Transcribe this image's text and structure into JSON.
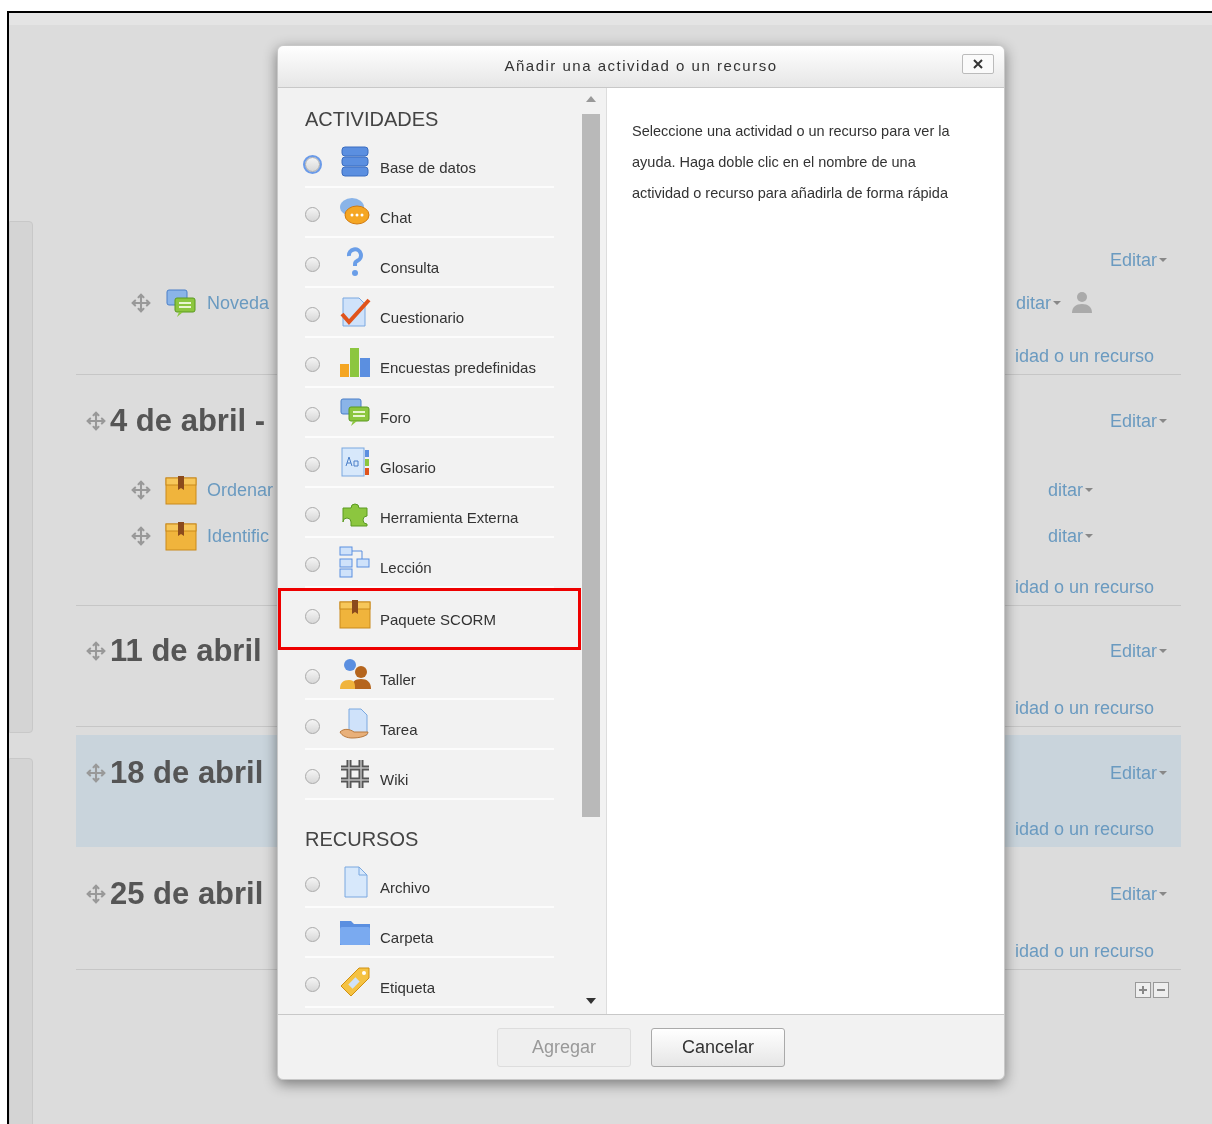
{
  "course": {
    "sections": [
      {
        "edit": "Editar",
        "items": [
          {
            "title": "Noveda",
            "edit": "ditar",
            "kind": "forum"
          }
        ],
        "add": "idad o un recurso",
        "highlighted": false
      },
      {
        "title": "4 de abril -",
        "edit": "Editar",
        "items": [
          {
            "title": "Ordenar",
            "edit": "ditar",
            "kind": "package"
          },
          {
            "title": "Identific",
            "edit": "ditar",
            "kind": "package"
          }
        ],
        "add": "idad o un recurso",
        "highlighted": false
      },
      {
        "title": "11 de abril",
        "edit": "Editar",
        "add": "idad o un recurso",
        "highlighted": false
      },
      {
        "title": "18 de abril",
        "edit": "Editar",
        "add": "idad o un recurso",
        "highlighted": true
      },
      {
        "title": "25 de abril",
        "edit": "Editar",
        "add": "idad o un recurso",
        "highlighted": false
      }
    ]
  },
  "dialog": {
    "title": "Añadir una actividad o un recurso",
    "groups": [
      {
        "heading": "ACTIVIDADES",
        "items": [
          {
            "label": "Base de datos",
            "focused": true,
            "highlighted": false
          },
          {
            "label": "Chat",
            "focused": false,
            "highlighted": false
          },
          {
            "label": "Consulta",
            "focused": false,
            "highlighted": false
          },
          {
            "label": "Cuestionario",
            "focused": false,
            "highlighted": false
          },
          {
            "label": "Encuestas predefinidas",
            "focused": false,
            "highlighted": false
          },
          {
            "label": "Foro",
            "focused": false,
            "highlighted": false
          },
          {
            "label": "Glosario",
            "focused": false,
            "highlighted": false
          },
          {
            "label": "Herramienta Externa",
            "focused": false,
            "highlighted": false
          },
          {
            "label": "Lección",
            "focused": false,
            "highlighted": false
          },
          {
            "label": "Paquete SCORM",
            "focused": false,
            "highlighted": true
          },
          {
            "label": "Taller",
            "focused": false,
            "highlighted": false
          },
          {
            "label": "Tarea",
            "focused": false,
            "highlighted": false
          },
          {
            "label": "Wiki",
            "focused": false,
            "highlighted": false
          }
        ]
      },
      {
        "heading": "RECURSOS",
        "items": [
          {
            "label": "Archivo",
            "focused": false,
            "highlighted": false
          },
          {
            "label": "Carpeta",
            "focused": false,
            "highlighted": false
          },
          {
            "label": "Etiqueta",
            "focused": false,
            "highlighted": false
          }
        ]
      }
    ],
    "help": "Seleccione una actividad o un recurso para ver la ayuda. Haga doble clic en el nombre de una actividad o recurso para añadirla de forma rápida",
    "buttons": [
      {
        "label": "Agregar",
        "disabled": true
      },
      {
        "label": "Cancelar",
        "disabled": false
      }
    ]
  }
}
